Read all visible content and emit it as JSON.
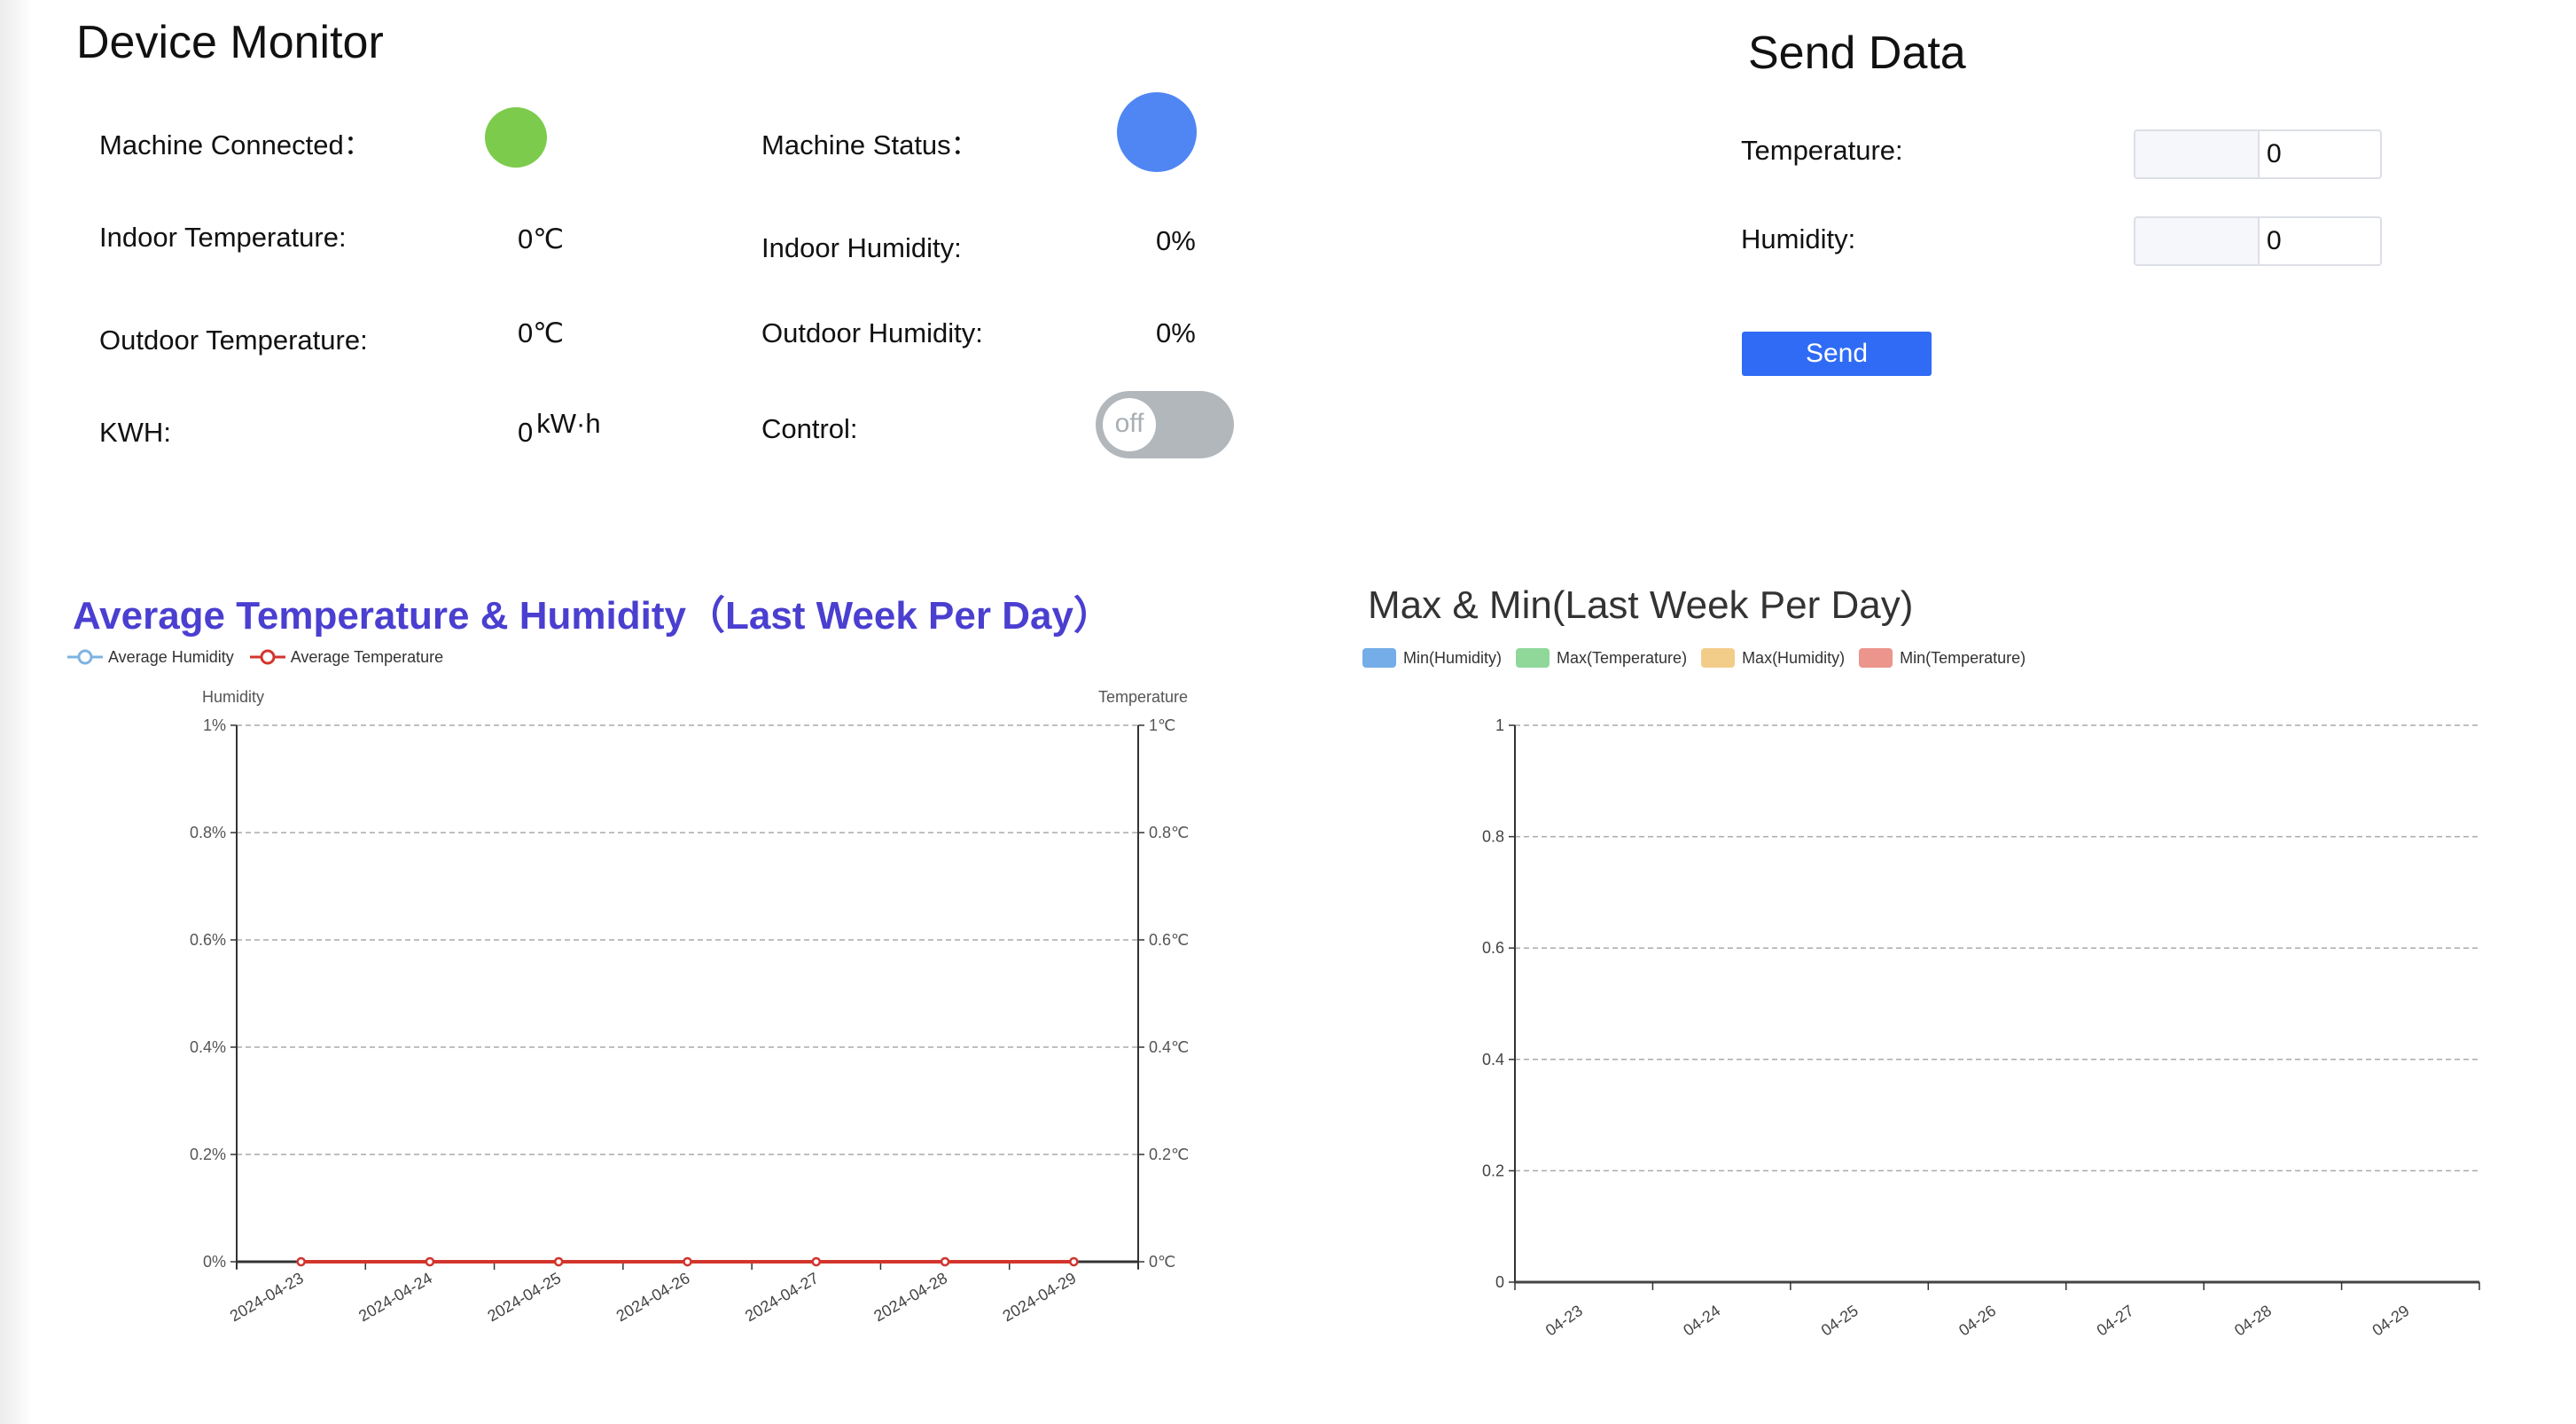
{
  "monitor": {
    "title": "Device Monitor",
    "connected_label": "Machine Connected：",
    "connected_color": "#7ccb4c",
    "status_label": "Machine Status：",
    "status_color": "#4f86f3",
    "indoor_temp_label": "Indoor Temperature:",
    "indoor_temp_value": "0",
    "temp_unit": "℃",
    "indoor_hum_label": "Indoor Humidity:",
    "indoor_hum_value": "0%",
    "outdoor_temp_label": "Outdoor Temperature:",
    "outdoor_temp_value": "0",
    "outdoor_hum_label": "Outdoor Humidity:",
    "outdoor_hum_value": "0%",
    "kwh_label": "KWH:",
    "kwh_value": "0",
    "kwh_unit": "kW·h",
    "control_label": "Control:",
    "control_state": "off"
  },
  "send": {
    "title": "Send Data",
    "temperature_label": "Temperature:",
    "temperature_value": "0",
    "humidity_label": "Humidity:",
    "humidity_value": "0",
    "send_label": "Send"
  },
  "chart_data": [
    {
      "type": "line",
      "title": "Average Temperature & Humidity（Last Week Per Day）",
      "categories": [
        "2024-04-23",
        "2024-04-24",
        "2024-04-25",
        "2024-04-26",
        "2024-04-27",
        "2024-04-28",
        "2024-04-29"
      ],
      "series": [
        {
          "name": "Average Humidity",
          "color": "#7eb3e0",
          "axis": "left",
          "values": [
            0,
            0,
            0,
            0,
            0,
            0,
            0
          ]
        },
        {
          "name": "Average Temperature",
          "color": "#d2352d",
          "axis": "right",
          "values": [
            0,
            0,
            0,
            0,
            0,
            0,
            0
          ]
        }
      ],
      "ylabel_left": "Humidity",
      "ylabel_right": "Temperature",
      "yticks_left": [
        "0%",
        "0.2%",
        "0.4%",
        "0.6%",
        "0.8%",
        "1%"
      ],
      "yticks_right": [
        "0℃",
        "0.2℃",
        "0.4℃",
        "0.6℃",
        "0.8℃",
        "1℃"
      ],
      "ylim": [
        0,
        1
      ],
      "grid": true,
      "legend": "top-left"
    },
    {
      "type": "bar",
      "title": "Max & Min(Last Week Per Day)",
      "categories": [
        "04-23",
        "04-24",
        "04-25",
        "04-26",
        "04-27",
        "04-28",
        "04-29"
      ],
      "series": [
        {
          "name": "Min(Humidity)",
          "color": "#74ade8",
          "values": [
            0,
            0,
            0,
            0,
            0,
            0,
            0
          ]
        },
        {
          "name": "Max(Temperature)",
          "color": "#8fd89a",
          "values": [
            0,
            0,
            0,
            0,
            0,
            0,
            0
          ]
        },
        {
          "name": "Max(Humidity)",
          "color": "#f2cd8a",
          "values": [
            0,
            0,
            0,
            0,
            0,
            0,
            0
          ]
        },
        {
          "name": "Min(Temperature)",
          "color": "#eb958c",
          "values": [
            0,
            0,
            0,
            0,
            0,
            0,
            0
          ]
        }
      ],
      "yticks": [
        "0",
        "0.2",
        "0.4",
        "0.6",
        "0.8",
        "1"
      ],
      "ylim": [
        0,
        1
      ],
      "grid": true,
      "legend": "top-left"
    }
  ]
}
